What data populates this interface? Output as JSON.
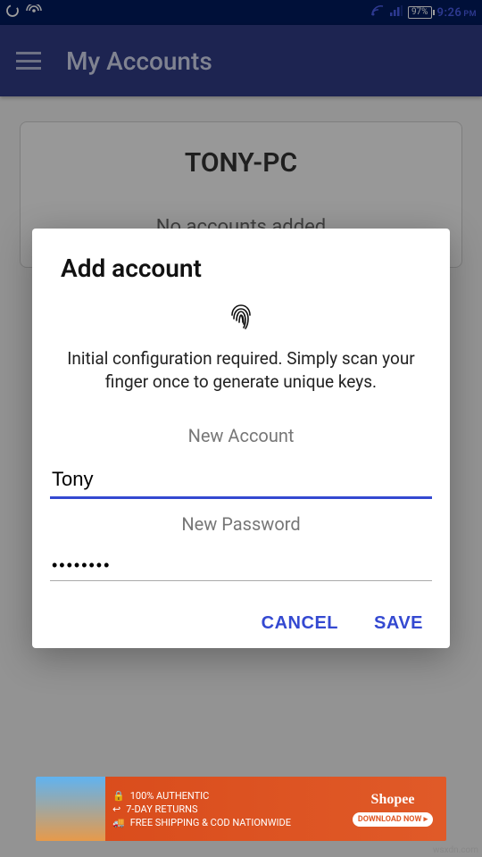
{
  "status": {
    "battery": "97%",
    "time": "9:26",
    "period": "PM"
  },
  "appbar": {
    "title": "My Accounts"
  },
  "card": {
    "title": "TONY-PC",
    "message": "No accounts added"
  },
  "dialog": {
    "title": "Add account",
    "message": "Initial configuration required. Simply scan your finger once to generate unique keys.",
    "account_label": "New Account",
    "account_value": "Tony",
    "password_label": "New Password",
    "password_value": "••••••••",
    "cancel": "CANCEL",
    "save": "SAVE"
  },
  "ad": {
    "line1": "100% AUTHENTIC",
    "line2": "7-DAY RETURNS",
    "line3": "FREE SHIPPING & COD NATIONWIDE",
    "brand": "Shopee",
    "cta": "DOWNLOAD NOW ▸"
  },
  "watermark": "wsxdn.com"
}
